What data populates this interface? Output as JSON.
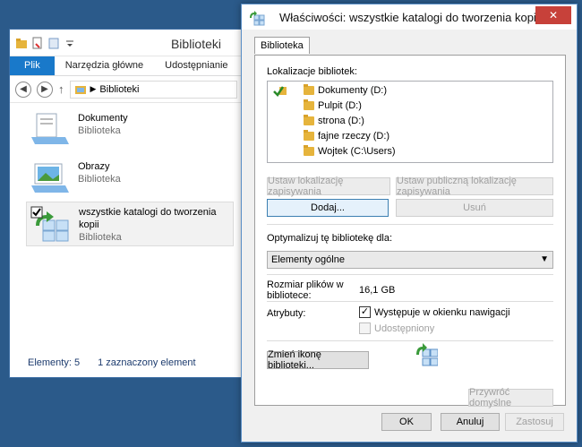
{
  "explorer": {
    "title": "Biblioteki",
    "ribbon_tabs": [
      "Plik",
      "Narzędzia główne",
      "Udostępnianie"
    ],
    "address": "Biblioteki",
    "items": [
      {
        "name": "Dokumenty",
        "kind": "Biblioteka"
      },
      {
        "name": "Obrazy",
        "kind": "Biblioteka"
      },
      {
        "name": "wszystkie katalogi do tworzenia kopii",
        "kind": "Biblioteka"
      }
    ],
    "status": {
      "count": "Elementy: 5",
      "selected": "1 zaznaczony element"
    }
  },
  "dialog": {
    "title": "Właściwości: wszystkie katalogi do tworzenia kopii",
    "close": "✕",
    "tab": "Biblioteka",
    "locations_label": "Lokalizacje bibliotek:",
    "locations": [
      "Dokumenty (D:)",
      "Pulpit (D:)",
      "strona (D:)",
      "fajne rzeczy (D:)",
      "Wojtek (C:\\Users)"
    ],
    "btn_set_save": "Ustaw lokalizację zapisywania",
    "btn_set_public": "Ustaw publiczną lokalizację zapisywania",
    "btn_add": "Dodaj...",
    "btn_remove": "Usuń",
    "optimize_label": "Optymalizuj tę bibliotekę dla:",
    "optimize_value": "Elementy ogólne",
    "size_label": "Rozmiar plików w bibliotece:",
    "size_value": "16,1 GB",
    "attrs_label": "Atrybuty:",
    "attr_nav": "Występuje w okienku nawigacji",
    "attr_shared": "Udostępniony",
    "btn_change_icon": "Zmień ikonę biblioteki...",
    "btn_restore": "Przywróć domyślne",
    "btn_ok": "OK",
    "btn_cancel": "Anuluj",
    "btn_apply": "Zastosuj"
  }
}
